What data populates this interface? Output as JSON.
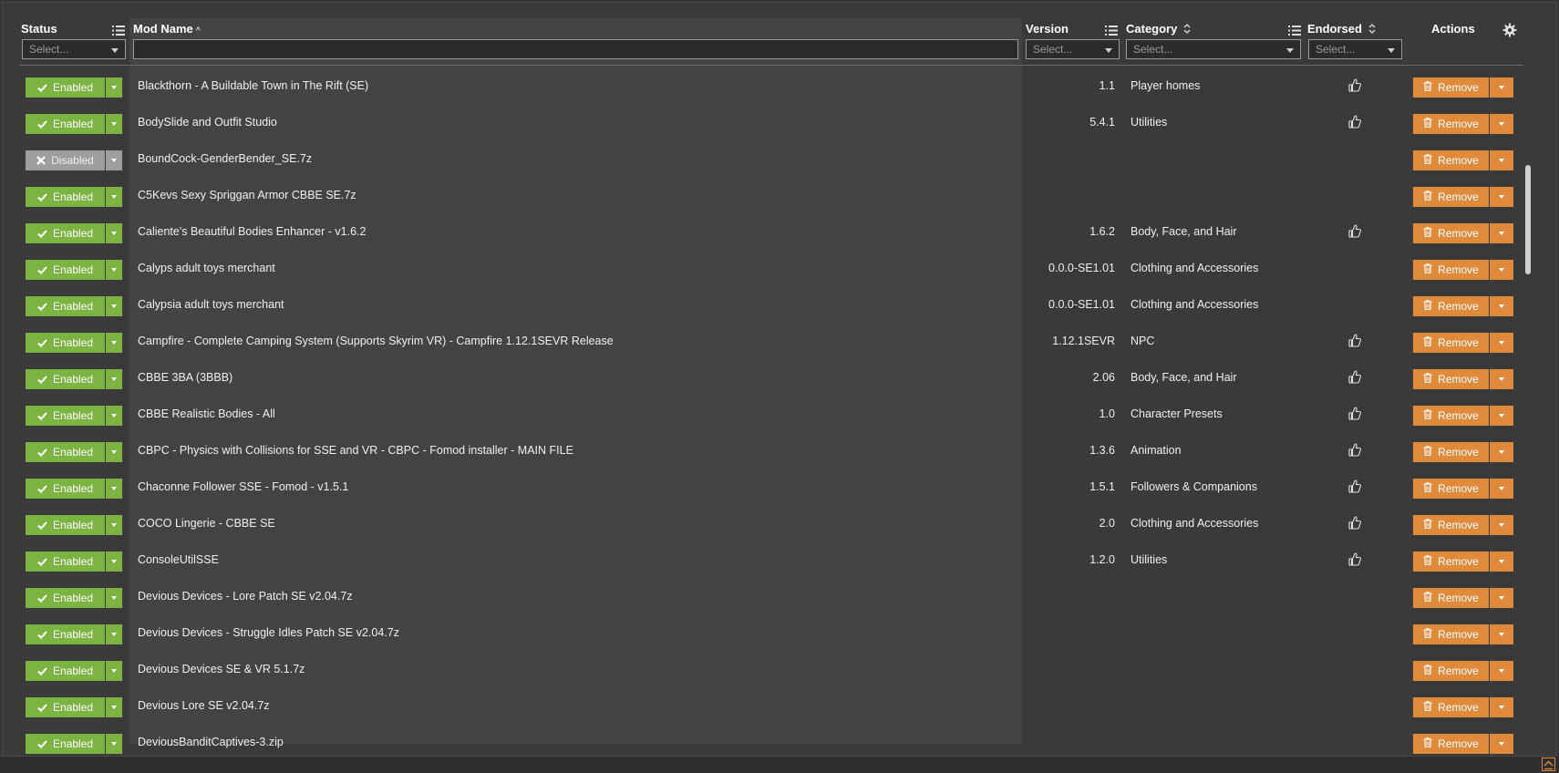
{
  "header": {
    "status": "Status",
    "mod_name": "Mod Name",
    "mod_name_sort": "^",
    "version": "Version",
    "category": "Category",
    "endorsed": "Endorsed",
    "actions": "Actions",
    "filter_placeholder": "Select..."
  },
  "rows": [
    {
      "status": "Enabled",
      "name": "Blackthorn - A Buildable Town in The Rift (SE)",
      "version": "1.1",
      "category": "Player homes",
      "endorsed": true,
      "action": "Remove"
    },
    {
      "status": "Enabled",
      "name": "BodySlide and Outfit Studio",
      "version": "5.4.1",
      "category": "Utilities",
      "endorsed": true,
      "action": "Remove"
    },
    {
      "status": "Disabled",
      "name": "BoundCock-GenderBender_SE.7z",
      "version": "",
      "category": "",
      "endorsed": false,
      "action": "Remove"
    },
    {
      "status": "Enabled",
      "name": "C5Kevs Sexy Spriggan Armor CBBE SE.7z",
      "version": "",
      "category": "",
      "endorsed": false,
      "action": "Remove"
    },
    {
      "status": "Enabled",
      "name": "Caliente's Beautiful Bodies Enhancer - v1.6.2",
      "version": "1.6.2",
      "category": "Body, Face, and Hair",
      "endorsed": true,
      "action": "Remove"
    },
    {
      "status": "Enabled",
      "name": "Calyps adult toys merchant",
      "version": "0.0.0-SE1.01",
      "category": "Clothing and Accessories",
      "endorsed": false,
      "action": "Remove"
    },
    {
      "status": "Enabled",
      "name": "Calypsia adult toys merchant",
      "version": "0.0.0-SE1.01",
      "category": "Clothing and Accessories",
      "endorsed": false,
      "action": "Remove"
    },
    {
      "status": "Enabled",
      "name": "Campfire - Complete Camping System (Supports Skyrim VR) - Campfire 1.12.1SEVR Release",
      "version": "1.12.1SEVR",
      "category": "NPC",
      "endorsed": true,
      "action": "Remove"
    },
    {
      "status": "Enabled",
      "name": "CBBE 3BA (3BBB)",
      "version": "2.06",
      "category": "Body, Face, and Hair",
      "endorsed": true,
      "action": "Remove"
    },
    {
      "status": "Enabled",
      "name": "CBBE Realistic Bodies - All",
      "version": "1.0",
      "category": "Character Presets",
      "endorsed": true,
      "action": "Remove"
    },
    {
      "status": "Enabled",
      "name": "CBPC - Physics with Collisions for SSE and VR - CBPC - Fomod installer - MAIN FILE",
      "version": "1.3.6",
      "category": "Animation",
      "endorsed": true,
      "action": "Remove"
    },
    {
      "status": "Enabled",
      "name": "Chaconne Follower SSE - Fomod - v1.5.1",
      "version": "1.5.1",
      "category": "Followers & Companions",
      "endorsed": true,
      "action": "Remove"
    },
    {
      "status": "Enabled",
      "name": "COCO Lingerie - CBBE SE",
      "version": "2.0",
      "category": "Clothing and Accessories",
      "endorsed": true,
      "action": "Remove"
    },
    {
      "status": "Enabled",
      "name": "ConsoleUtilSSE",
      "version": "1.2.0",
      "category": "Utilities",
      "endorsed": true,
      "action": "Remove"
    },
    {
      "status": "Enabled",
      "name": "Devious Devices - Lore Patch SE v2.04.7z",
      "version": "",
      "category": "",
      "endorsed": false,
      "action": "Remove"
    },
    {
      "status": "Enabled",
      "name": "Devious Devices - Struggle Idles Patch SE v2.04.7z",
      "version": "",
      "category": "",
      "endorsed": false,
      "action": "Remove"
    },
    {
      "status": "Enabled",
      "name": "Devious Devices SE & VR 5.1.7z",
      "version": "",
      "category": "",
      "endorsed": false,
      "action": "Remove"
    },
    {
      "status": "Enabled",
      "name": "Devious Lore SE v2.04.7z",
      "version": "",
      "category": "",
      "endorsed": false,
      "action": "Remove"
    },
    {
      "status": "Enabled",
      "name": "DeviousBanditCaptives-3.zip",
      "version": "",
      "category": "",
      "endorsed": false,
      "action": "Remove"
    }
  ],
  "colors": {
    "enabled": "#7cb342",
    "disabled": "#9e9e9e",
    "remove": "#e08a3c"
  }
}
